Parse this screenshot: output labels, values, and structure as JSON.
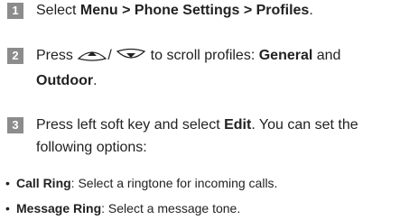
{
  "steps": [
    {
      "num": "1",
      "pre": "Select ",
      "bold": "Menu > Phone Settings > Profiles",
      "post": "."
    },
    {
      "num": "2",
      "pre": "Press ",
      "sep": "/ ",
      "mid": " to scroll profiles: ",
      "bold1": "General",
      "and": " and ",
      "bold2": "Outdoor",
      "post": "."
    },
    {
      "num": "3",
      "pre": "Press left soft key and select ",
      "bold": "Edit",
      "post": ". You can set the following options:"
    }
  ],
  "bullets": [
    {
      "dot": "•",
      "bold": "Call Ring",
      "text": ": Select a ringtone for incoming calls."
    },
    {
      "dot": "•",
      "bold": "Message Ring",
      "text": ": Select a message tone."
    }
  ],
  "icons": {
    "up": "up-key-icon",
    "down": "down-key-icon"
  },
  "colors": {
    "badge": "#8c8c8c",
    "text": "#222222"
  }
}
